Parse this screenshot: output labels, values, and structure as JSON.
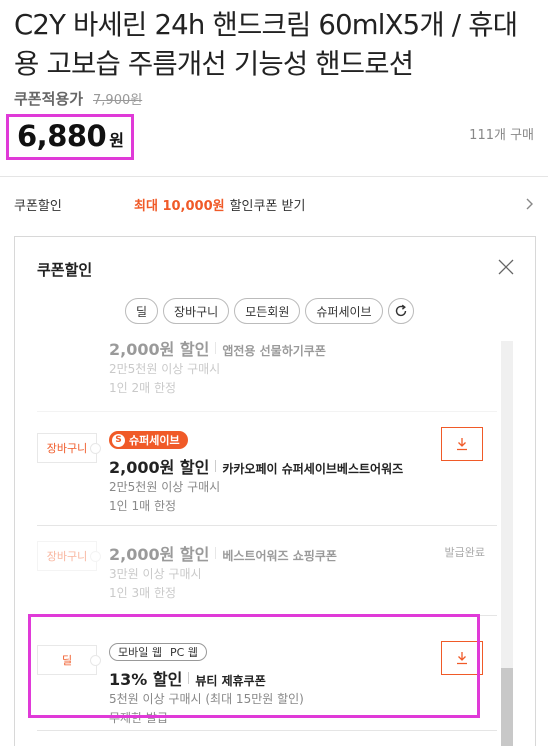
{
  "product": {
    "title": "C2Y 바세린 24h 핸드크림 60mlX5개 / 휴대용 고보습 주름개선 기능성 핸드로션",
    "coupon_price_label": "쿠폰적용가",
    "original_price": "7,900원",
    "sale_price": "6,880",
    "price_unit": "원",
    "purchase_count": "111개 구매"
  },
  "coupon_row": {
    "label": "쿠폰할인",
    "max_discount": "최대 10,000원",
    "text": "할인쿠폰 받기"
  },
  "panel": {
    "title": "쿠폰할인",
    "filters": [
      "딜",
      "장바구니",
      "모든회원",
      "슈퍼세이브"
    ],
    "items": [
      {
        "amount": "2,000원 할인",
        "name": "앱전용 선물하기쿠폰",
        "condition": "2만5천원 이상 구매시",
        "limit": "1인 2매 한정"
      },
      {
        "type": "장바구니",
        "badge": "슈퍼세이브",
        "badge_letter": "S",
        "amount": "2,000원 할인",
        "name": "카카오페이 슈퍼세이브베스트어워즈",
        "condition": "2만5천원 이상 구매시",
        "limit": "1인 1매 한정"
      },
      {
        "type": "장바구니",
        "amount": "2,000원 할인",
        "name": "베스트어워즈 쇼핑쿠폰",
        "condition": "3만원 이상 구매시",
        "limit": "1인 3매 한정",
        "status": "발급완료"
      },
      {
        "type": "딜",
        "badge_mobile": "모바일 웹",
        "badge_pc": "PC 웹",
        "amount": "13% 할인",
        "name": "뷰티 제휴쿠폰",
        "condition": "5천원 이상 구매시 (최대 15만원 할인)",
        "limit": "무제한 발급"
      }
    ]
  },
  "colors": {
    "accent": "#f05a28",
    "highlight": "#e03ad8"
  }
}
